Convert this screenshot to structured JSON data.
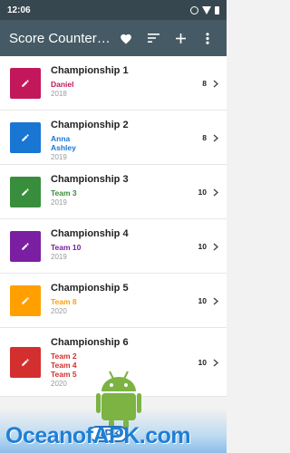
{
  "status_bar": {
    "time": "12:06"
  },
  "app_bar": {
    "title": "Score Counter…",
    "actions": [
      "heart-icon",
      "sort-icon",
      "add-icon",
      "more-vert-icon"
    ]
  },
  "championships": [
    {
      "title": "Championship 1",
      "players": [
        "Daniel"
      ],
      "year": "2018",
      "score": "8",
      "color": "#c2185b"
    },
    {
      "title": "Championship 2",
      "players": [
        "Anna",
        "Ashley"
      ],
      "year": "2019",
      "score": "8",
      "color": "#1976d2"
    },
    {
      "title": "Championship 3",
      "players": [
        "Team 3"
      ],
      "year": "2019",
      "score": "10",
      "color": "#388e3c"
    },
    {
      "title": "Championship 4",
      "players": [
        "Team 10"
      ],
      "year": "2019",
      "score": "10",
      "color": "#7b1fa2"
    },
    {
      "title": "Championship 5",
      "players": [
        "Team 8"
      ],
      "year": "2020",
      "score": "10",
      "color": "#ffa000"
    },
    {
      "title": "Championship 6",
      "players": [
        "Team 2",
        "Team 4",
        "Team 5"
      ],
      "year": "2020",
      "score": "10",
      "color": "#d32f2f"
    }
  ],
  "watermark": {
    "text": "OceanofAPK.com",
    "badge": "APK"
  }
}
